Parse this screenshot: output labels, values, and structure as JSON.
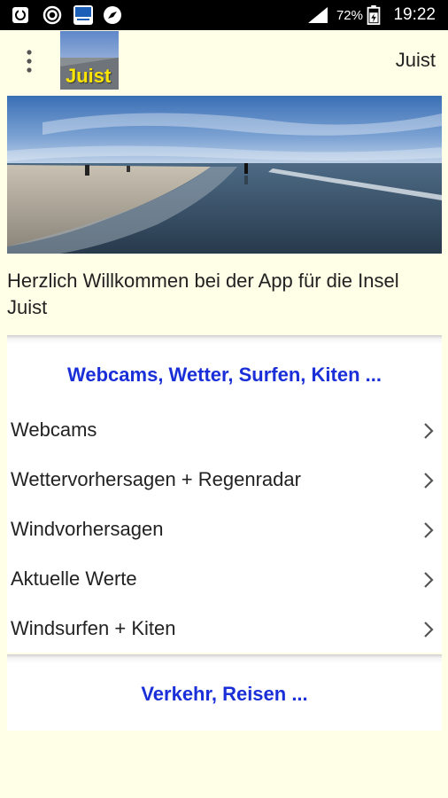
{
  "status_bar": {
    "battery_percent": "72%",
    "time": "19:22",
    "icons": [
      "sync-box-icon",
      "target-icon",
      "haz-app-icon",
      "compass-icon",
      "signal-icon",
      "battery-icon"
    ]
  },
  "app_bar": {
    "logo_text": "Juist",
    "title": "Juist",
    "menu_icon": "more-vert-icon"
  },
  "welcome_text": "Herzlich Willkommen bei der App für die Insel Juist",
  "sections": [
    {
      "title": "Webcams, Wetter, Surfen, Kiten ...",
      "items": [
        {
          "label": "Webcams"
        },
        {
          "label": "Wettervorhersagen + Regenradar"
        },
        {
          "label": "Windvorhersagen"
        },
        {
          "label": "Aktuelle Werte"
        },
        {
          "label": "Windsurfen + Kiten"
        }
      ]
    },
    {
      "title": "Verkehr, Reisen ...",
      "items": []
    }
  ],
  "colors": {
    "background": "#fffee6",
    "section_title": "#1a2fd8",
    "status_bar": "#000000"
  }
}
